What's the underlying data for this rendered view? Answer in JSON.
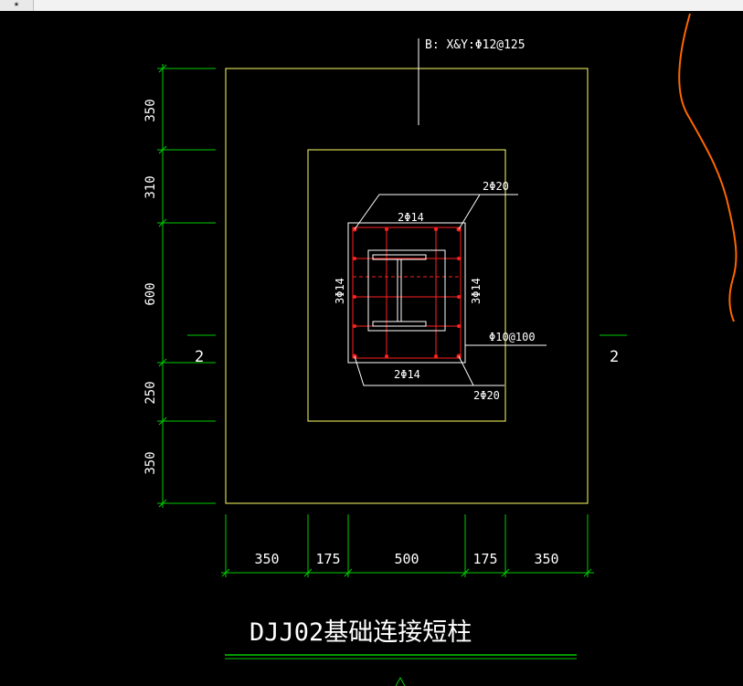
{
  "window": {
    "tool_glyph": "★"
  },
  "drawing": {
    "title": "DJJ02基础连接短柱",
    "footing_rebar_label": "B: X&Y:Φ12@125",
    "corner_bar_top": "2Φ20",
    "corner_bar_bottom": "2Φ20",
    "side_bar_top": "2Φ14",
    "side_bar_bottom": "2Φ14",
    "side_bar_left": "3Φ14",
    "side_bar_right": "3Φ14",
    "stirrup_label": "Φ10@100",
    "section_left": "2",
    "section_right": "2",
    "vertical_dims": [
      "350",
      "310",
      "600",
      "250",
      "350"
    ],
    "horizontal_dims": [
      "350",
      "175",
      "500",
      "175",
      "350"
    ]
  },
  "colors": {
    "background": "#000000",
    "outline": "#ffff66",
    "dimension": "#00cc00",
    "rebar": "#ff2020",
    "text": "#ffffff",
    "curve": "#ff6600",
    "underline": "#00cc00"
  }
}
